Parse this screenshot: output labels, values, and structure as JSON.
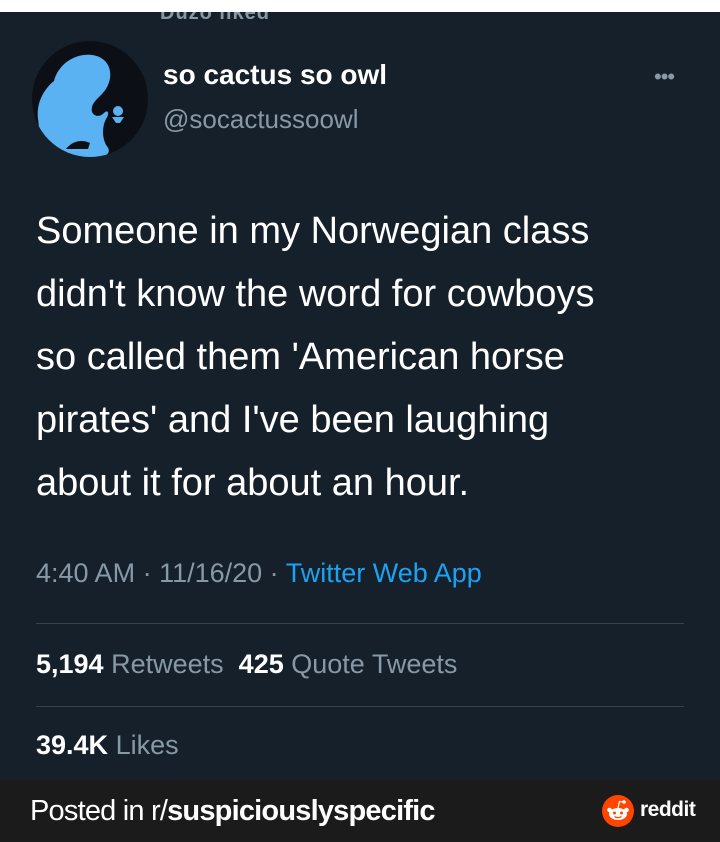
{
  "tweet": {
    "context_line": "Duzo liked",
    "display_name": "so cactus so owl",
    "handle": "@socactussoowl",
    "text_lines": [
      "Someone in my Norwegian class",
      "didn't know the word for cowboys",
      "so called them 'American horse",
      "pirates' and I've been laughing",
      "about it for about an hour."
    ],
    "time": "4:40 AM",
    "date": "11/16/20",
    "separator": " · ",
    "source": "Twitter Web App",
    "retweets_count": "5,194",
    "retweets_label": "Retweets",
    "quote_count": "425",
    "quote_label": "Quote Tweets",
    "likes_count": "39.4K",
    "likes_label": "Likes",
    "more_icon": "•••"
  },
  "footer": {
    "posted_prefix": "Posted in r/",
    "subreddit": "suspiciouslyspecific",
    "brand": "reddit"
  },
  "colors": {
    "background": "#15202b",
    "text": "#ffffff",
    "muted": "#8899a6",
    "link": "#1da1f2",
    "avatar_figure": "#5ab2f3",
    "reddit": "#ff4500"
  }
}
